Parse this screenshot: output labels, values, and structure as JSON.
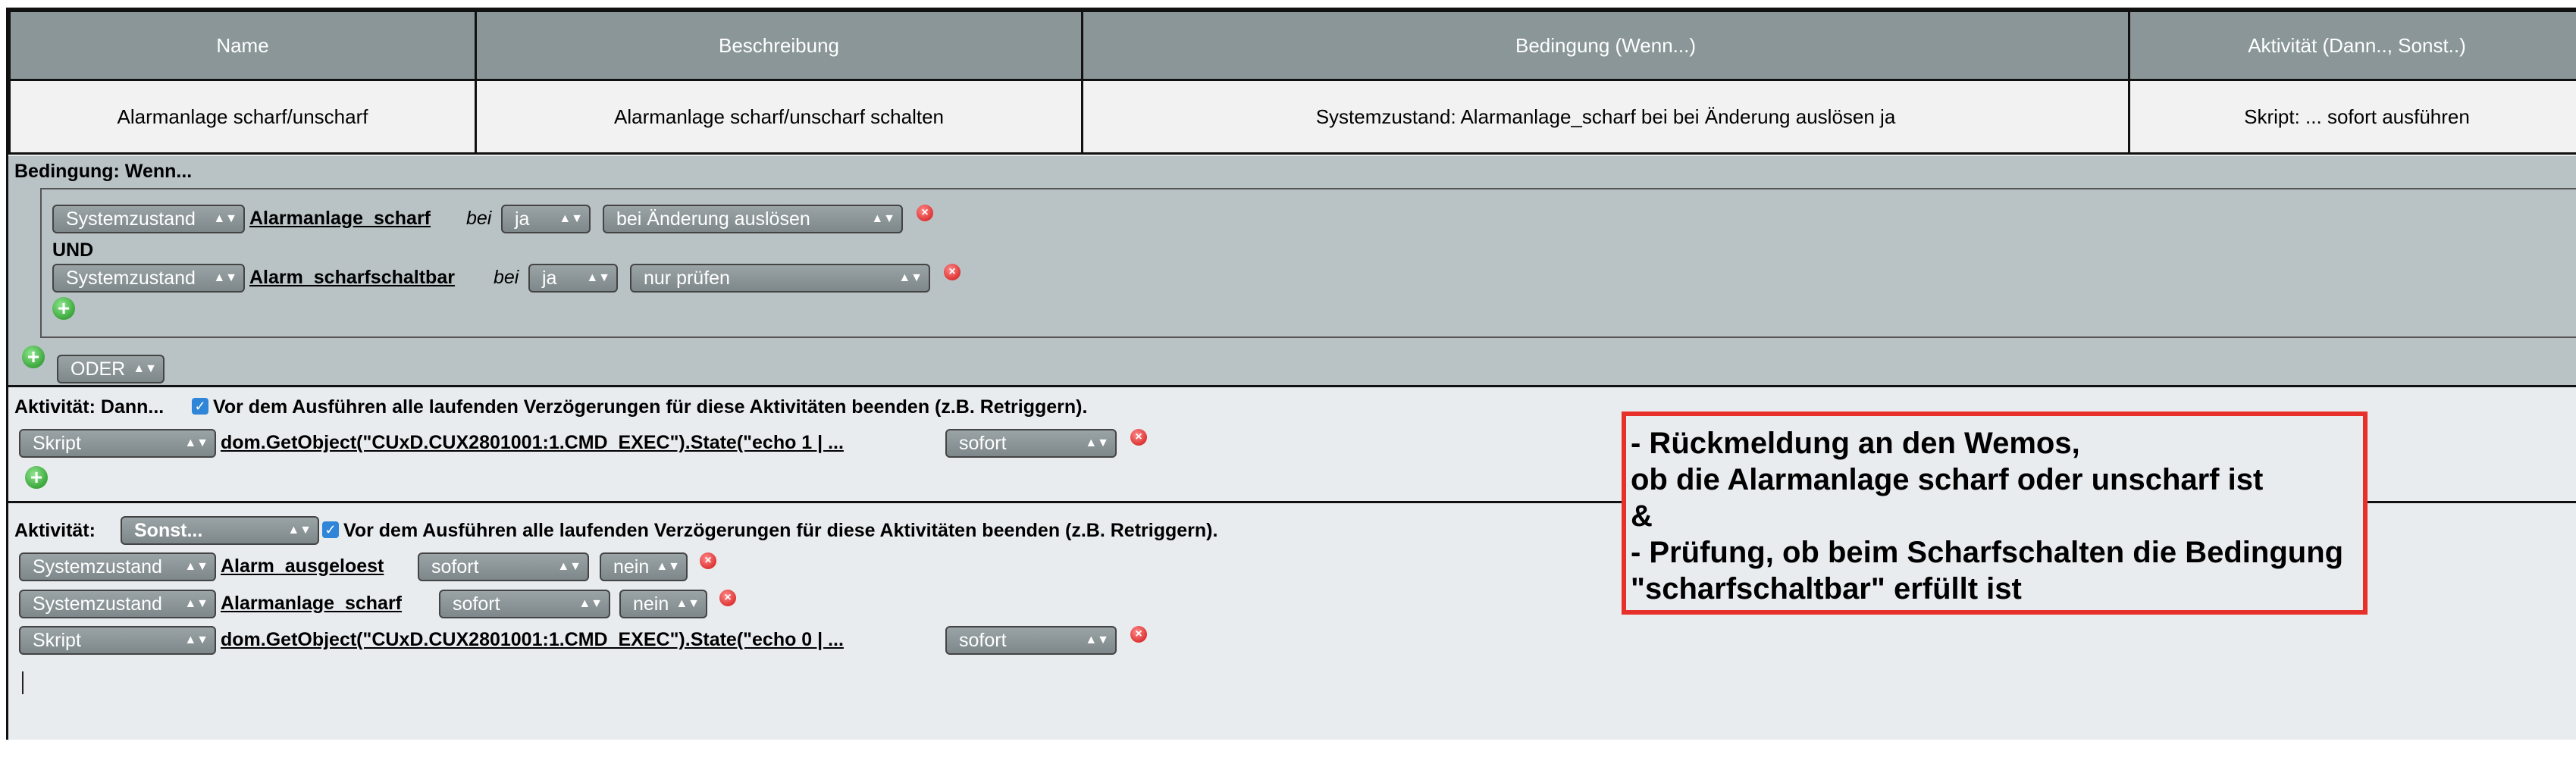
{
  "table": {
    "headers": [
      "Name",
      "Beschreibung",
      "Bedingung (Wenn...)",
      "Aktivität (Dann.., Sonst..)"
    ],
    "row": [
      "Alarmanlage scharf/unscharf",
      "Alarmanlage scharf/unscharf schalten",
      "Systemzustand: Alarmanlage_scharf bei bei Änderung auslösen ja",
      "Skript: ... sofort ausführen"
    ]
  },
  "condition": {
    "title": "Bedingung: Wenn...",
    "rows": [
      {
        "type": "Systemzustand",
        "name": "Alarmanlage_scharf",
        "bei": "bei",
        "value": "ja",
        "trigger": "bei Änderung auslösen"
      },
      {
        "type": "Systemzustand",
        "name": "Alarm_scharfschaltbar",
        "bei": "bei",
        "value": "ja",
        "trigger": "nur prüfen"
      }
    ],
    "und": "UND",
    "oder": "ODER"
  },
  "dann": {
    "title": "Aktivität: Dann...",
    "checkbox_label": "Vor dem Ausführen alle laufenden Verzögerungen für diese Aktivitäten beenden (z.B. Retriggern).",
    "rows": [
      {
        "type": "Skript",
        "script": "dom.GetObject(\"CUxD.CUX2801001:1.CMD_EXEC\").State(\"echo 1 | ...",
        "timing": "sofort"
      }
    ]
  },
  "sonst": {
    "title": "Aktivität:",
    "select": "Sonst...",
    "checkbox_label": "Vor dem Ausführen alle laufenden Verzögerungen für diese Aktivitäten beenden (z.B. Retriggern).",
    "rows": [
      {
        "type": "Systemzustand",
        "name": "Alarm_ausgeloest",
        "timing": "sofort",
        "value": "nein"
      },
      {
        "type": "Systemzustand",
        "name": "Alarmanlage_scharf",
        "timing": "sofort",
        "value": "nein"
      },
      {
        "type": "Skript",
        "script": "dom.GetObject(\"CUxD.CUX2801001:1.CMD_EXEC\").State(\"echo 0 | ...",
        "timing": "sofort"
      }
    ]
  },
  "annotation": {
    "lines": [
      "- Rückmeldung an den Wemos,",
      "ob die Alarmanlage scharf oder unscharf ist",
      "&",
      "- Prüfung, ob beim Scharfschalten die Bedingung",
      "\"scharfschaltbar\" erfüllt ist"
    ]
  },
  "icons": {
    "delete": "delete-icon",
    "add": "add-icon",
    "checkbox": "checkbox-checked-icon"
  },
  "colors": {
    "header_bg": "#8a9698",
    "condition_bg": "#b9c3c6",
    "activity_bg": "#e8ecee",
    "annotation_border": "#e8302a"
  }
}
